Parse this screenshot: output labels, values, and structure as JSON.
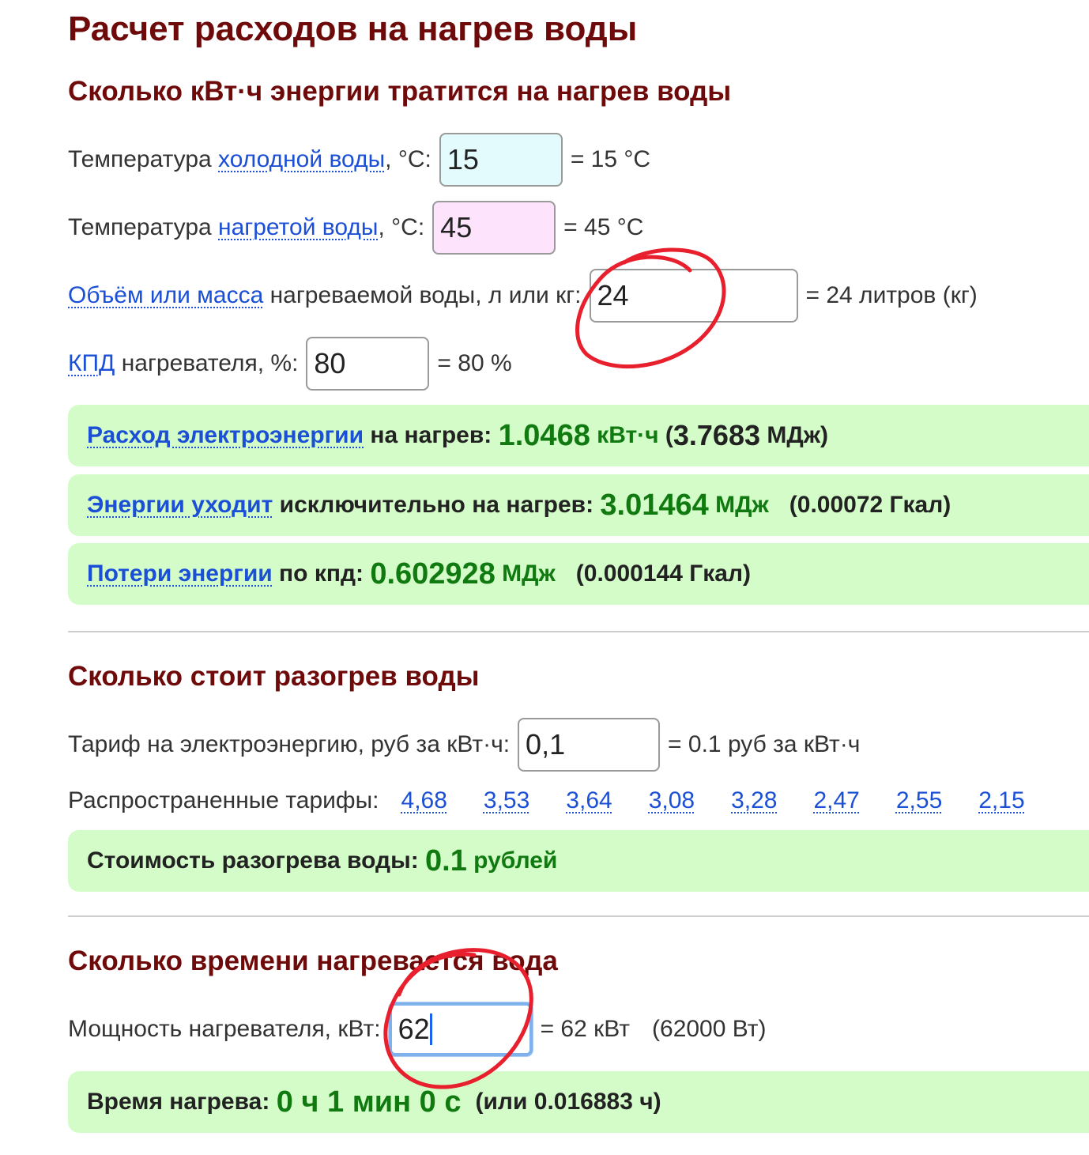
{
  "page_title": "Расчет расходов на нагрев воды",
  "section_energy": {
    "title": "Сколько кВт·ч энергии тратится на нагрев воды",
    "cold": {
      "prefix": "Температура ",
      "link": "холодной воды",
      "suffix": ", °C:",
      "value": "15",
      "result": "= 15 °C"
    },
    "hot": {
      "prefix": "Температура ",
      "link": "нагретой воды",
      "suffix": ", °C:",
      "value": "45",
      "result": "= 45 °C"
    },
    "volume": {
      "link": "Объём или масса",
      "suffix": " нагреваемой воды, л или кг:",
      "value": "24",
      "result": "= 24 литров (кг)"
    },
    "efficiency": {
      "link": "КПД",
      "suffix": " нагревателя, %:",
      "value": "80",
      "result": "= 80 %"
    },
    "result_power": {
      "link": "Расход электроэнергии",
      "label": " на нагрев: ",
      "value": "1.0468",
      "unit": " кВт·ч",
      "open": " (",
      "value2": "3.7683",
      "unit2": " МДж)"
    },
    "result_heat": {
      "link": "Энергии уходит",
      "label": " исключительно на нагрев: ",
      "value": "3.01464",
      "unit": " МДж",
      "extra": "(0.00072 Гкал)"
    },
    "result_loss": {
      "link": "Потери энергии",
      "label": " по кпд: ",
      "value": "0.602928",
      "unit": " МДж",
      "extra": "(0.000144 Гкал)"
    }
  },
  "section_cost": {
    "title": "Сколько стоит разогрев воды",
    "tariff": {
      "label": "Тариф на электроэнергию, руб за кВт·ч:",
      "value": "0,1",
      "result": "= 0.1 руб за кВт·ч"
    },
    "common_label": "Распространенные тарифы:",
    "common_tariffs": [
      "4,68",
      "3,53",
      "3,64",
      "3,08",
      "3,28",
      "2,47",
      "2,55",
      "2,15"
    ],
    "result": {
      "label": "Стоимость разогрева воды: ",
      "value": "0.1",
      "unit": " рублей"
    }
  },
  "section_time": {
    "title": "Сколько времени нагревается вода",
    "power": {
      "label": "Мощность нагревателя, кВт:",
      "value": "62",
      "result": "= 62 кВт",
      "result2": "(62000 Вт)"
    },
    "result": {
      "label": "Время нагрева: ",
      "value": "0 ч 1 мин 0 с",
      "extra": "(или 0.016883 ч)"
    }
  },
  "colors": {
    "heading": "#6e0a0a",
    "link": "#1a4fd6",
    "result_bg": "#d3fcc8",
    "result_value": "#107a10",
    "annotation": "#e8202e"
  }
}
